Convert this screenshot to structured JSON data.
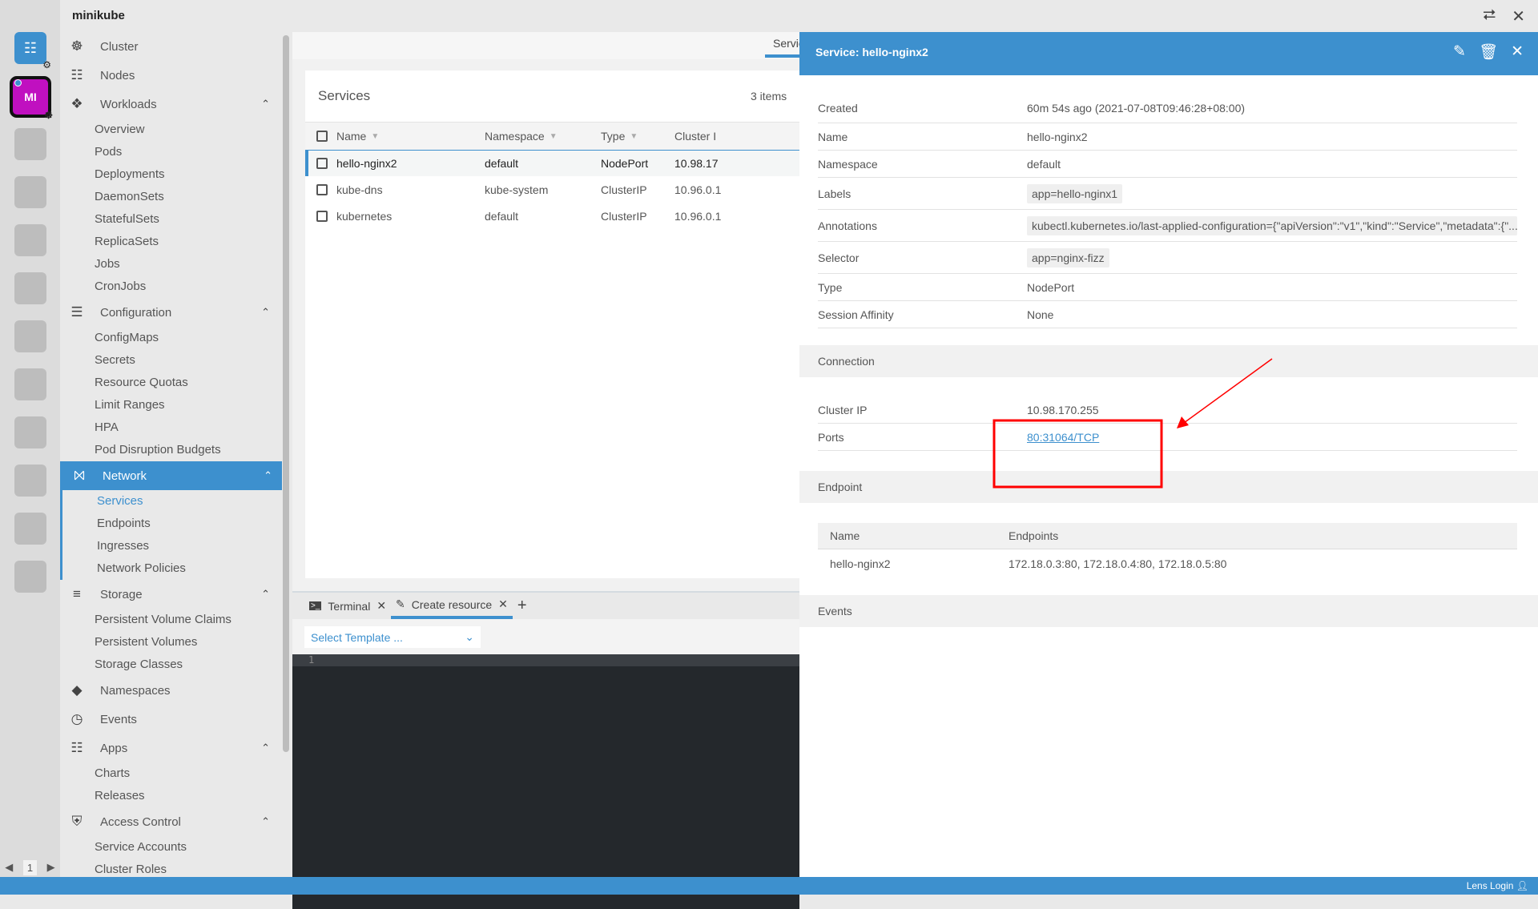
{
  "app": {
    "title": "minikube",
    "share_icon": "share-icon",
    "close_icon": "close-icon"
  },
  "dock": {
    "cluster_initials": "MI",
    "page": "1"
  },
  "sidebar": {
    "items": [
      {
        "label": "Cluster",
        "icon": "cluster-helm-icon"
      },
      {
        "label": "Nodes",
        "icon": "nodes-icon"
      },
      {
        "label": "Workloads",
        "icon": "workloads-icon",
        "children": [
          "Overview",
          "Pods",
          "Deployments",
          "DaemonSets",
          "StatefulSets",
          "ReplicaSets",
          "Jobs",
          "CronJobs"
        ]
      },
      {
        "label": "Configuration",
        "icon": "list-icon",
        "children": [
          "ConfigMaps",
          "Secrets",
          "Resource Quotas",
          "Limit Ranges",
          "HPA",
          "Pod Disruption Budgets"
        ]
      },
      {
        "label": "Network",
        "icon": "network-icon",
        "active": true,
        "children": [
          "Services",
          "Endpoints",
          "Ingresses",
          "Network Policies"
        ],
        "selected": "Services"
      },
      {
        "label": "Storage",
        "icon": "storage-icon",
        "children": [
          "Persistent Volume Claims",
          "Persistent Volumes",
          "Storage Classes"
        ]
      },
      {
        "label": "Namespaces",
        "icon": "layers-icon"
      },
      {
        "label": "Events",
        "icon": "clock-icon"
      },
      {
        "label": "Apps",
        "icon": "apps-grid-icon",
        "children": [
          "Charts",
          "Releases"
        ]
      },
      {
        "label": "Access Control",
        "icon": "shield-icon",
        "children": [
          "Service Accounts",
          "Cluster Roles"
        ]
      }
    ]
  },
  "main": {
    "tab": "Services",
    "card_title": "Services",
    "count": "3 items",
    "columns": [
      "Name",
      "Namespace",
      "Type",
      "Cluster I"
    ],
    "rows": [
      {
        "name": "hello-nginx2",
        "namespace": "default",
        "type": "NodePort",
        "cluster_ip": "10.98.17",
        "selected": true
      },
      {
        "name": "kube-dns",
        "namespace": "kube-system",
        "type": "ClusterIP",
        "cluster_ip": "10.96.0.1"
      },
      {
        "name": "kubernetes",
        "namespace": "default",
        "type": "ClusterIP",
        "cluster_ip": "10.96.0.1"
      }
    ]
  },
  "dock_panel": {
    "tabs": [
      {
        "label": "Terminal"
      },
      {
        "label": "Create resource",
        "active": true
      }
    ],
    "template_placeholder": "Select Template ...",
    "line_number": "1"
  },
  "detail": {
    "title": "Service: hello-nginx2",
    "fields": [
      {
        "key": "Created",
        "value": "60m 54s ago (2021-07-08T09:46:28+08:00)"
      },
      {
        "key": "Name",
        "value": "hello-nginx2"
      },
      {
        "key": "Namespace",
        "value": "default"
      },
      {
        "key": "Labels",
        "value": "app=hello-nginx1"
      },
      {
        "key": "Annotations",
        "value": "kubectl.kubernetes.io/last-applied-configuration={\"apiVersion\":\"v1\",\"kind\":\"Service\",\"metadata\":{\"..."
      },
      {
        "key": "Selector",
        "value": "app=nginx-fizz"
      },
      {
        "key": "Type",
        "value": "NodePort"
      },
      {
        "key": "Session Affinity",
        "value": "None"
      }
    ],
    "connection_title": "Connection",
    "connection": [
      {
        "key": "Cluster IP",
        "value": "10.98.170.255"
      },
      {
        "key": "Ports",
        "value": "80:31064/TCP"
      }
    ],
    "endpoint_title": "Endpoint",
    "endpoint_columns": [
      "Name",
      "Endpoints"
    ],
    "endpoint_rows": [
      {
        "name": "hello-nginx2",
        "endpoints": "172.18.0.3:80, 172.18.0.4:80, 172.18.0.5:80"
      }
    ],
    "events_title": "Events"
  },
  "statusbar": {
    "login": "Lens Login"
  },
  "colors": {
    "accent": "#3d90ce",
    "annotation": "#ff0000",
    "cluster_icon": "#c010c0"
  }
}
